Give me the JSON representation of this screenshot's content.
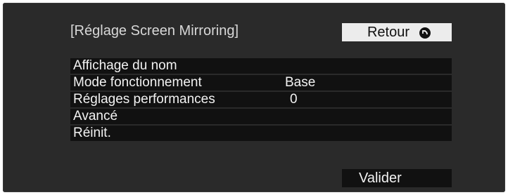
{
  "header": {
    "title": "[Réglage Screen Mirroring]",
    "back_label": "Retour",
    "back_icon": "return-circle-icon"
  },
  "menu": {
    "items": [
      {
        "label": "Affichage du nom",
        "value": ""
      },
      {
        "label": "Mode fonctionnement",
        "value": "Base"
      },
      {
        "label": "Réglages performances",
        "value": "0"
      },
      {
        "label": "Avancé",
        "value": ""
      },
      {
        "label": "Réinit.",
        "value": ""
      }
    ]
  },
  "footer": {
    "ok_label": "Valider"
  },
  "colors": {
    "screen_bg": "#2a2a2a",
    "row_bg": "#111111",
    "button_light_bg": "#ececec",
    "text_light": "#f2f2f2",
    "title_text": "#d8d8d8"
  }
}
